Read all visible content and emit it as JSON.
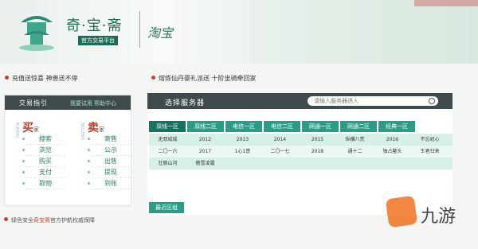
{
  "header": {
    "title": "奇·宝·斋",
    "subtitle": "官方交易平台",
    "calligraphy": "淘宝"
  },
  "notices": [
    "充值送惊喜 神兽送不停",
    "熔炼仙丹豪礼派送 十阶坐骑牵回家"
  ],
  "left": {
    "title": "交易指引",
    "links": [
      "我要试用",
      "帮助中心"
    ],
    "buy": {
      "head": "买",
      "small": "家",
      "vert": "BUYERS",
      "items": [
        "搜索",
        "浏览",
        "购买",
        "支付",
        "取物"
      ]
    },
    "sell": {
      "head": "卖",
      "small": "家",
      "vert": "SELLERS",
      "items": [
        "寄售",
        "公示",
        "出售",
        "提现",
        "到账"
      ]
    },
    "footer_pre": "绿色安全",
    "footer_hl": "奇宝斋",
    "footer_post": "官方护航权威保障"
  },
  "main": {
    "title": "选择服务器",
    "search_placeholder": "请输入服务器进入",
    "tabs": [
      "双线一区",
      "双线二区",
      "电信一区",
      "电信二区",
      "网通一区",
      "网通二区",
      "经典一区"
    ],
    "rows": [
      [
        "无双城城",
        "2012",
        "2013",
        "2014",
        "2015",
        "纵横八荒",
        "2016",
        "不忘初心"
      ],
      [
        "二〇一六",
        "2017",
        "1心1意",
        "二〇一七",
        "2018",
        "通十二",
        "独占鳌头",
        "王者归来"
      ],
      [
        "壮丽山河",
        "傲雪凌霜",
        "",
        "",
        "",
        "",
        "",
        ""
      ]
    ],
    "recent": "最近区组"
  },
  "watermark": "九游",
  "colors": {
    "accent": "#2f9b86",
    "dark": "#3f4a4d",
    "red": "#c23a2a"
  }
}
